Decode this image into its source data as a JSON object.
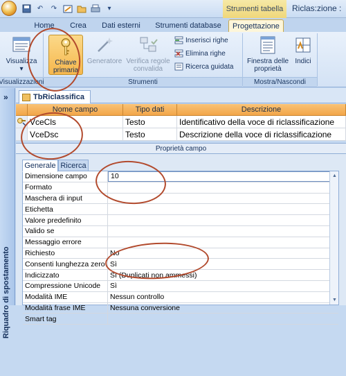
{
  "titlebar": {
    "context_tab": "Strumenti tabella",
    "title": "Riclas:zione :",
    "qat_icons": [
      "save-icon",
      "undo-icon",
      "redo-icon",
      "design-icon",
      "open-icon",
      "print-icon",
      "dropdown-icon"
    ]
  },
  "tabs": [
    {
      "label": "Home"
    },
    {
      "label": "Crea"
    },
    {
      "label": "Dati esterni"
    },
    {
      "label": "Strumenti database"
    },
    {
      "label": "Progettazione"
    }
  ],
  "ribbon": {
    "view_button": "Visualizza",
    "key_button": "Chiave primaria",
    "builder_button": "Generatore",
    "validation_button": "Verifica regole convalida",
    "insert_rows": "Inserisci righe",
    "delete_rows": "Elimina righe",
    "lookup_wizard": "Ricerca guidata",
    "property_sheet": "Finestra delle proprietà",
    "indexes": "Indici",
    "groups": {
      "views": "Visualizzazioni",
      "tools": "Strumenti",
      "show_hide": "Mostra/Nascondi"
    }
  },
  "nav": {
    "chevron": "»",
    "pane_label": "Riquadro di spostamento"
  },
  "document": {
    "tab_label": "TbRiclassifica"
  },
  "fields_grid": {
    "headers": [
      "Nome campo",
      "Tipo dati",
      "Descrizione"
    ],
    "rows": [
      {
        "name": "VceCls",
        "type": "Testo",
        "description": "Identificativo della voce di riclassificazione"
      },
      {
        "name": "VceDsc",
        "type": "Testo",
        "description": "Descrizione della voce di riclassificazione"
      }
    ]
  },
  "field_properties": {
    "section_title": "Proprietà campo",
    "tabs": [
      "Generale",
      "Ricerca"
    ],
    "rows": [
      {
        "label": "Dimensione campo",
        "value": "10"
      },
      {
        "label": "Formato",
        "value": ""
      },
      {
        "label": "Maschera di input",
        "value": ""
      },
      {
        "label": "Etichetta",
        "value": ""
      },
      {
        "label": "Valore predefinito",
        "value": ""
      },
      {
        "label": "Valido se",
        "value": ""
      },
      {
        "label": "Messaggio errore",
        "value": ""
      },
      {
        "label": "Richiesto",
        "value": "No"
      },
      {
        "label": "Consenti lunghezza zero",
        "value": "Sì"
      },
      {
        "label": "Indicizzato",
        "value": "Sì (Duplicati non ammessi)"
      },
      {
        "label": "Compressione Unicode",
        "value": "Sì"
      },
      {
        "label": "Modalità IME",
        "value": "Nessun controllo"
      },
      {
        "label": "Modalità frase IME",
        "value": "Nessuna conversione"
      },
      {
        "label": "Smart tag",
        "value": ""
      }
    ]
  },
  "colors": {
    "annotation_ring": "#b24a2d",
    "grid_header": "#f2a649",
    "ribbon_bg": "#d3e2f5"
  }
}
